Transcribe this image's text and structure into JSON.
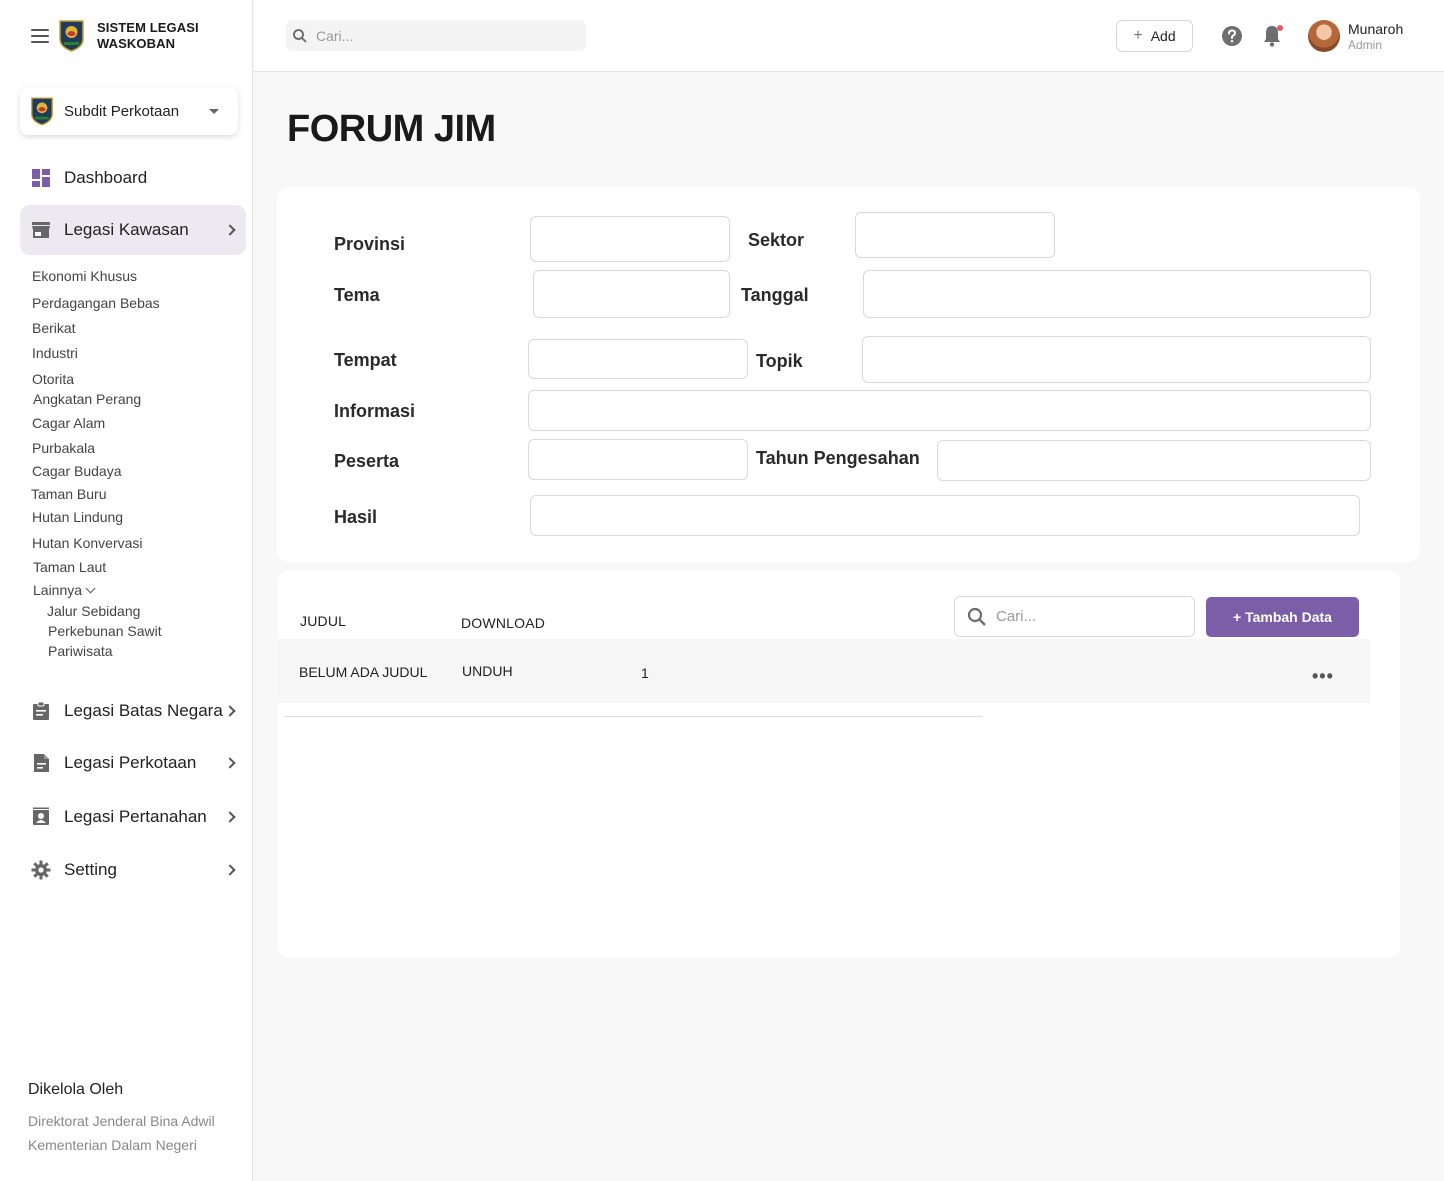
{
  "app": {
    "title_line1": "SISTEM LEGASI",
    "title_line2": "WASKOBAN"
  },
  "org_selector": {
    "label": "Subdit Perkotaan"
  },
  "sidebar": {
    "dashboard": "Dashboard",
    "legasi_kawasan": "Legasi Kawasan",
    "kawasan_items": [
      "Ekonomi Khusus",
      "Perdagangan Bebas",
      "Berikat",
      "Industri",
      "Otorita",
      "Angkatan Perang",
      "Cagar Alam",
      "Purbakala",
      "Cagar Budaya",
      "Taman Buru",
      "Hutan Lindung",
      "Hutan Konvervasi",
      "Taman Laut",
      "Lainnya"
    ],
    "lainnya_items": [
      "Jalur Sebidang",
      "Perkebunan Sawit",
      "Pariwisata"
    ],
    "legasi_batas_negara": "Legasi Batas Negara",
    "legasi_perkotaan": "Legasi Perkotaan",
    "legasi_pertanahan": "Legasi Pertanahan",
    "setting": "Setting"
  },
  "footer": {
    "title": "Dikelola Oleh",
    "line1": "Direktorat Jenderal Bina Adwil",
    "line2": "Kementerian Dalam Negeri"
  },
  "topbar": {
    "search_placeholder": "Cari...",
    "add_label": "Add",
    "user_name": "Munaroh",
    "user_role": "Admin"
  },
  "page": {
    "title": "FORUM JIM"
  },
  "form": {
    "provinsi": "Provinsi",
    "sektor": "Sektor",
    "tema": "Tema",
    "tanggal": "Tanggal",
    "tempat": "Tempat",
    "topik": "Topik",
    "informasi": "Informasi",
    "peserta": "Peserta",
    "tahun_pengesahan": "Tahun Pengesahan",
    "hasil": "Hasil"
  },
  "table": {
    "col_judul": "JUDUL",
    "col_download": "DOWNLOAD",
    "search_placeholder": "Cari...",
    "add_button": "+ Tambah Data",
    "rows": [
      {
        "judul": "BELUM ADA JUDUL",
        "download": "UNDUH",
        "count": "1",
        "menu": "•••"
      }
    ]
  },
  "colors": {
    "accent": "#7b5ea7",
    "active_nav_bg": "#ece9f1",
    "notification_dot": "#e65b5b"
  }
}
